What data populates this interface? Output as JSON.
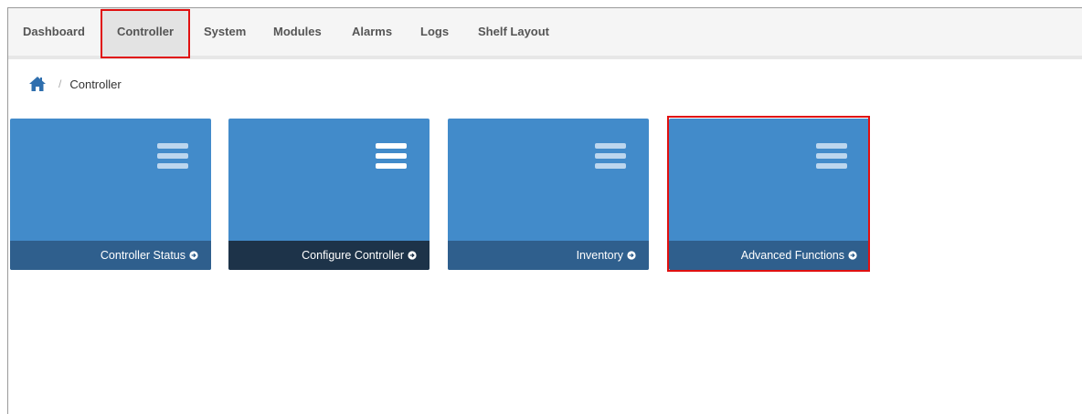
{
  "nav": {
    "items": [
      {
        "label": "Dashboard"
      },
      {
        "label": "Controller"
      },
      {
        "label": "System"
      },
      {
        "label": "Modules"
      },
      {
        "label": "Alarms"
      },
      {
        "label": "Logs"
      },
      {
        "label": "Shelf Layout"
      }
    ],
    "active": "Controller"
  },
  "breadcrumb": {
    "home_icon": "home-icon",
    "separator": "/",
    "current": "Controller"
  },
  "tiles": [
    {
      "label": "Controller Status",
      "icon": "menu-icon"
    },
    {
      "label": "Configure Controller",
      "icon": "menu-icon"
    },
    {
      "label": "Inventory",
      "icon": "menu-icon"
    },
    {
      "label": "Advanced Functions",
      "icon": "menu-icon"
    }
  ],
  "colors": {
    "tile": "#428bca",
    "tile_footer": "#2f5f8d",
    "tile_footer_hover": "#1d3349",
    "highlight": "#e01010",
    "nav_active": "#e3e3e3"
  }
}
